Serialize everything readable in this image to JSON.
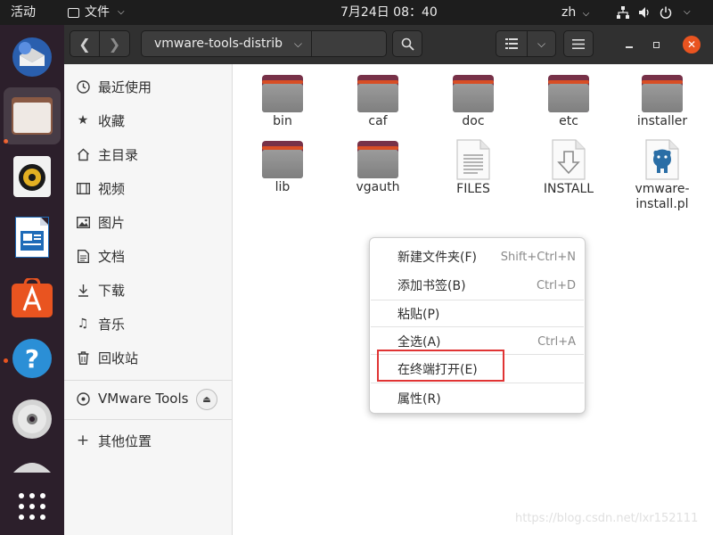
{
  "topbar": {
    "activities": "活动",
    "app_name": "文件",
    "clock": "7月24日  08：40",
    "language": "zh"
  },
  "dock": {
    "items": [
      {
        "icon": "thunderbird-icon"
      },
      {
        "icon": "files-icon",
        "active": true
      },
      {
        "icon": "rhythmbox-icon"
      },
      {
        "icon": "libreoffice-writer-icon"
      },
      {
        "icon": "ubuntu-software-icon"
      },
      {
        "icon": "help-icon"
      },
      {
        "icon": "dvd-icon"
      },
      {
        "icon": "partially-hidden-icon"
      },
      {
        "icon": "show-applications-icon"
      }
    ]
  },
  "header": {
    "path": "vmware-tools-distrib"
  },
  "sidebar": {
    "items": [
      {
        "label": "最近使用",
        "icon": "clock-icon"
      },
      {
        "label": "收藏",
        "icon": "star-icon"
      },
      {
        "label": "主目录",
        "icon": "home-icon"
      },
      {
        "label": "视频",
        "icon": "film-icon"
      },
      {
        "label": "图片",
        "icon": "image-icon"
      },
      {
        "label": "文档",
        "icon": "document-icon"
      },
      {
        "label": "下载",
        "icon": "download-icon"
      },
      {
        "label": "音乐",
        "icon": "music-icon"
      },
      {
        "label": "回收站",
        "icon": "trash-icon"
      }
    ],
    "device": {
      "label": "VMware Tools",
      "icon": "disc-icon"
    },
    "other": {
      "label": "其他位置",
      "icon": "plus-icon"
    }
  },
  "files": [
    {
      "name": "bin",
      "type": "folder"
    },
    {
      "name": "caf",
      "type": "folder"
    },
    {
      "name": "doc",
      "type": "folder"
    },
    {
      "name": "etc",
      "type": "folder"
    },
    {
      "name": "installer",
      "type": "folder"
    },
    {
      "name": "lib",
      "type": "folder"
    },
    {
      "name": "vgauth",
      "type": "folder"
    },
    {
      "name": "FILES",
      "type": "text"
    },
    {
      "name": "INSTALL",
      "type": "install"
    },
    {
      "name": "vmware-install.pl",
      "name_line1": "vmware-",
      "name_line2": "install.pl",
      "type": "perl"
    }
  ],
  "context_menu": {
    "items": [
      {
        "label": "新建文件夹(F)",
        "accel": "Shift+Ctrl+N"
      },
      {
        "label": "添加书签(B)",
        "accel": "Ctrl+D"
      },
      {
        "label": "粘贴(P)",
        "accel": ""
      },
      {
        "label": "全选(A)",
        "accel": "Ctrl+A"
      },
      {
        "label": "在终端打开(E)",
        "accel": ""
      },
      {
        "label": "属性(R)",
        "accel": ""
      }
    ]
  },
  "watermark": "https://blog.csdn.net/lxr152111",
  "colors": {
    "accent": "#e95420",
    "folder": "#773148",
    "highlight_box": "#e03434"
  }
}
